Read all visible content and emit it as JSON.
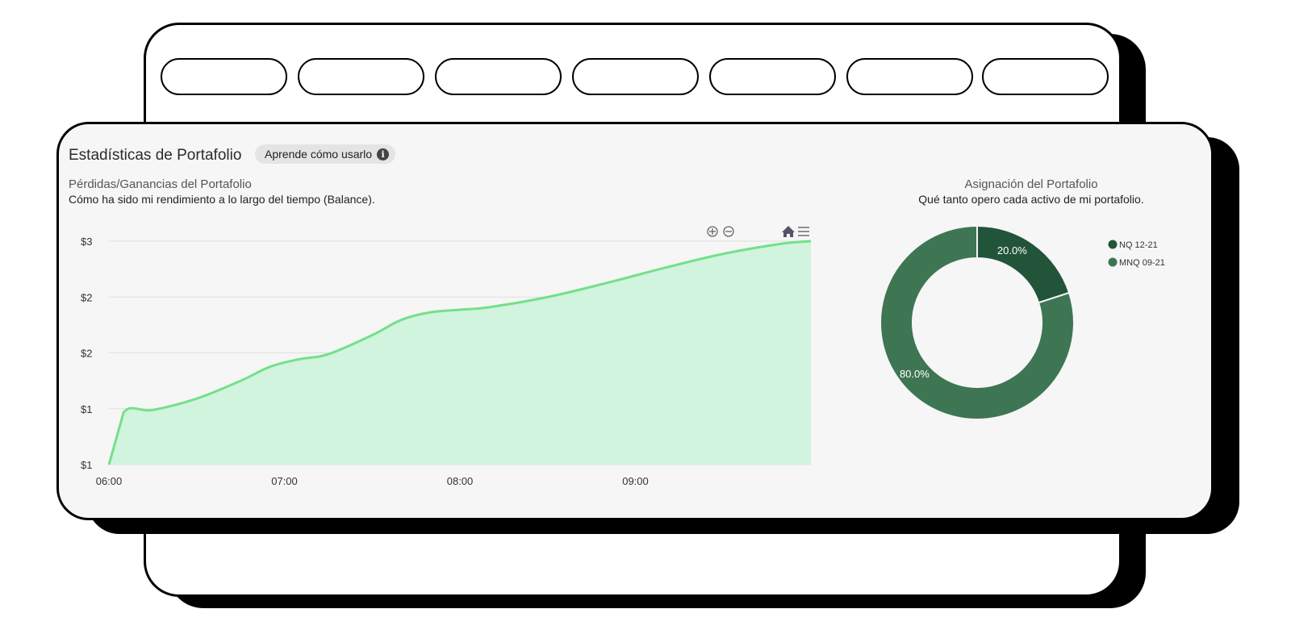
{
  "back_card": {
    "tabs": [
      "",
      "",
      "",
      "",
      "",
      "",
      ""
    ]
  },
  "panel": {
    "title": "Estadísticas de Portafolio",
    "learn_label": "Aprende cómo usarlo",
    "info_icon": "info-icon"
  },
  "pl_chart": {
    "title": "Pérdidas/Ganancias del Portafolio",
    "subtitle": "Cómo ha sido mi rendimiento a lo largo del tiempo (Balance).",
    "toolbar": [
      "zoom-in-icon",
      "zoom-out-icon",
      "home-icon",
      "menu-icon"
    ]
  },
  "alloc_chart": {
    "title": "Asignación del Portafolio",
    "subtitle": "Qué tanto opero cada activo de mi portafolio."
  },
  "colors": {
    "line": "#74e08a",
    "area": "#d0f4dd",
    "slice_nq": "#22543a",
    "slice_mnq": "#3e7654"
  },
  "chart_data": [
    {
      "type": "area",
      "x": [
        "06:00",
        "06:05",
        "06:15",
        "06:30",
        "06:45",
        "06:55",
        "07:05",
        "07:15",
        "07:30",
        "07:40",
        "07:50",
        "08:00",
        "08:10",
        "08:30",
        "08:50",
        "09:10",
        "09:30",
        "09:50",
        "10:00"
      ],
      "values": [
        1.0,
        1.41,
        1.43,
        1.52,
        1.66,
        1.77,
        1.83,
        1.87,
        2.02,
        2.14,
        2.2,
        2.22,
        2.24,
        2.32,
        2.43,
        2.55,
        2.66,
        2.74,
        2.76
      ],
      "x_tick_labels": [
        "06:00",
        "07:00",
        "08:00",
        "09:00"
      ],
      "y_tick_labels": [
        "$3",
        "$2",
        "$2",
        "$1",
        "$1"
      ],
      "ylim": [
        1.0,
        2.76
      ],
      "grid": true
    },
    {
      "type": "pie",
      "labels": [
        "NQ 12-21",
        "MNQ 09-21"
      ],
      "values": [
        20.0,
        80.0
      ],
      "data_labels": [
        "20.0%",
        "80.0%"
      ],
      "legend": "top-right"
    }
  ]
}
